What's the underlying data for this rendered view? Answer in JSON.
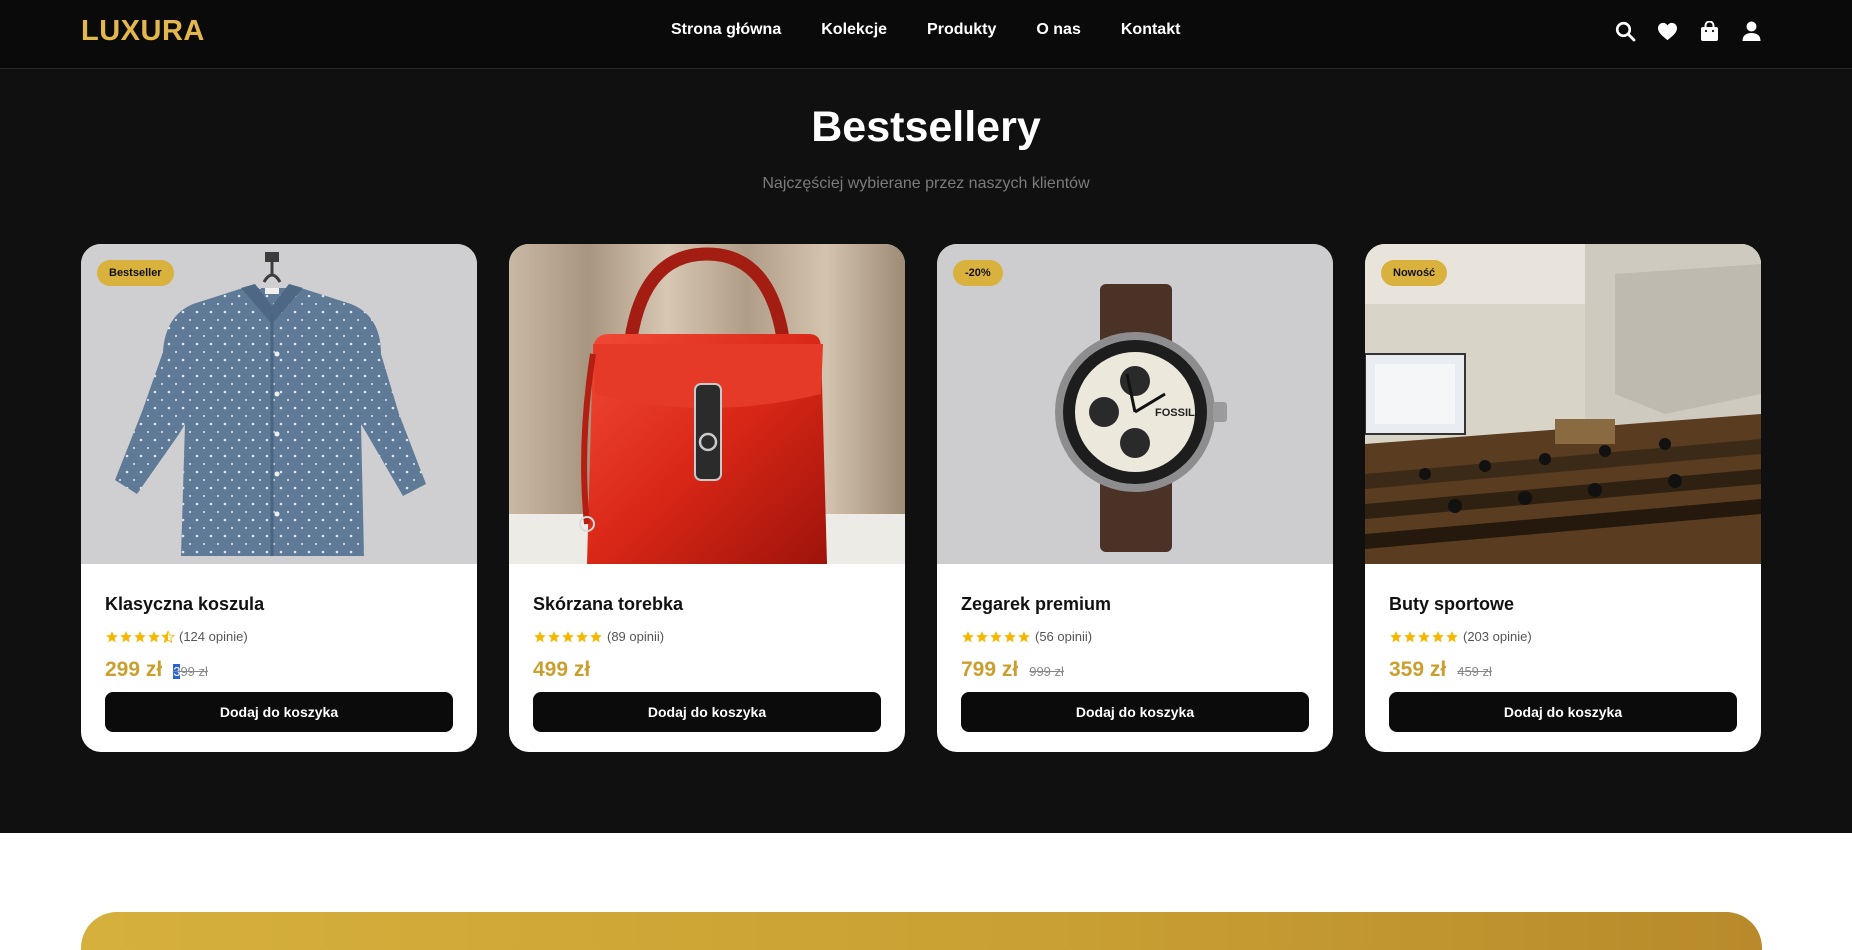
{
  "brand": {
    "logo": "LUXURA",
    "accent": "#e2b84c"
  },
  "nav": {
    "links": [
      "Strona główna",
      "Kolekcje",
      "Produkty",
      "O nas",
      "Kontakt"
    ],
    "icons": [
      "search-icon",
      "heart-icon",
      "shopping-bag-icon",
      "user-icon"
    ]
  },
  "section": {
    "title": "Bestsellery",
    "subtitle": "Najczęściej wybierane przez naszych klientów"
  },
  "products": [
    {
      "name": "Klasyczna koszula",
      "badge": "Bestseller",
      "rating": 4.5,
      "reviews": "(124 opinie)",
      "price": "299 zł",
      "old_price_sel": "3",
      "old_price_rest": "99 zł",
      "button": "Dodaj do koszyka"
    },
    {
      "name": "Skórzana torebka",
      "badge": "",
      "rating": 5,
      "reviews": "(89 opinii)",
      "price": "499 zł",
      "old_price_sel": "",
      "old_price_rest": "",
      "button": "Dodaj do koszyka"
    },
    {
      "name": "Zegarek premium",
      "badge": "-20%",
      "rating": 5,
      "reviews": "(56 opinii)",
      "price": "799 zł",
      "old_price_sel": "",
      "old_price_rest": "999 zł",
      "button": "Dodaj do koszyka"
    },
    {
      "name": "Buty sportowe",
      "badge": "Nowość",
      "rating": 5,
      "reviews": "(203 opinie)",
      "price": "359 zł",
      "old_price_sel": "",
      "old_price_rest": "459 zł",
      "button": "Dodaj do koszyka"
    }
  ],
  "watch_brand": "FOSSIL",
  "colors": {
    "star": "#f5b800",
    "price": "#c99f2f",
    "badge": "#d9b13d"
  }
}
